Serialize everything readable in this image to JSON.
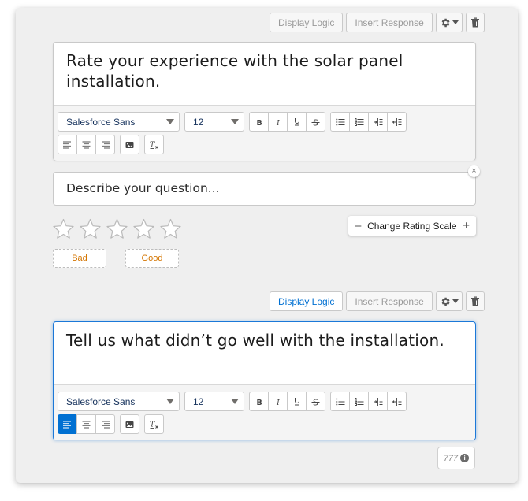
{
  "question1": {
    "toolbar": {
      "display_logic": "Display Logic",
      "insert_response": "Insert Response",
      "display_logic_active": false
    },
    "text": "Rate your experience with the solar panel installation.",
    "font_family": "Salesforce Sans",
    "font_size": "12"
  },
  "description_placeholder": "Describe your question...",
  "rating": {
    "star_count": 5,
    "change_scale_label": "Change Rating Scale",
    "minus": "–",
    "plus": "+",
    "low_label": "Bad",
    "high_label": "Good"
  },
  "question2": {
    "toolbar": {
      "display_logic": "Display Logic",
      "insert_response": "Insert Response",
      "display_logic_active": true
    },
    "text": "Tell us what didn’t go well with the installation.",
    "font_family": "Salesforce Sans",
    "font_size": "12",
    "align_left_active": true
  },
  "char_counter": "777",
  "close_glyph": "×",
  "colors": {
    "accent": "#0070d2",
    "orange_label": "#d47500",
    "card_bg": "#efefef"
  },
  "icons": [
    "gear-icon",
    "chevron-down-icon",
    "trash-icon",
    "bold-icon",
    "italic-icon",
    "underline-icon",
    "strikethrough-icon",
    "bulleted-list-icon",
    "numbered-list-icon",
    "indent-icon",
    "outdent-icon",
    "align-left-icon",
    "align-center-icon",
    "align-right-icon",
    "image-icon",
    "clear-format-icon",
    "star-icon",
    "info-icon"
  ]
}
